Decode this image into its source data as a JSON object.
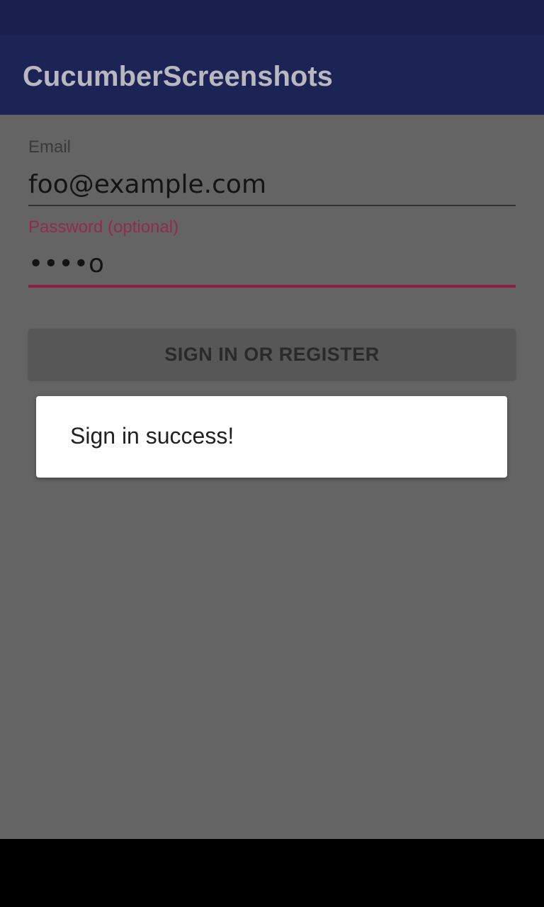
{
  "app_bar": {
    "title": "CucumberScreenshots"
  },
  "form": {
    "email": {
      "label": "Email",
      "value": "foo@example.com"
    },
    "password": {
      "label": "Password (optional)",
      "value": "••••o"
    },
    "submit_label": "SIGN IN OR REGISTER"
  },
  "dialog": {
    "message": "Sign in success!"
  },
  "colors": {
    "primary": "#1c2456",
    "accent": "#8a1f42",
    "scrim_background": "#646464"
  }
}
